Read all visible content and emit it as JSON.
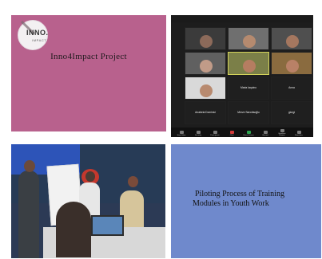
{
  "tiles": {
    "pink": {
      "logo_main": "INNO.",
      "logo_sub": "IMPACT",
      "title": "Inno4Impact Project",
      "bg_color": "#b8618d"
    },
    "zoom": {
      "participants": [
        {
          "name": "",
          "type": "video",
          "bg": "#3b3b3b",
          "head": "#8c6a5a",
          "active": false
        },
        {
          "name": "",
          "type": "video",
          "bg": "#6f6f6f",
          "head": "#b58a6f",
          "active": false
        },
        {
          "name": "",
          "type": "video",
          "bg": "#4f4f4f",
          "head": "#a5775f",
          "active": false
        },
        {
          "name": "",
          "type": "video",
          "bg": "#606060",
          "head": "#c19b88",
          "active": false
        },
        {
          "name": "",
          "type": "video",
          "bg": "#7b7f48",
          "head": "#b57d61",
          "active": true
        },
        {
          "name": "",
          "type": "video",
          "bg": "#8a6b3f",
          "head": "#b98167",
          "active": false
        },
        {
          "name": "",
          "type": "video",
          "bg": "#d9d9d9",
          "head": "#b88a6f",
          "active": false
        },
        {
          "name": "Maria Iaquino",
          "type": "text",
          "active": false
        },
        {
          "name": "Anna",
          "type": "text",
          "active": false
        },
        {
          "name": "Anabela Dominici",
          "type": "text",
          "active": false
        },
        {
          "name": "Merve Sarıcitaoğlu",
          "type": "text",
          "active": false
        },
        {
          "name": "giorgi",
          "type": "text",
          "active": false
        }
      ],
      "toolbar": [
        {
          "label": "Stop Video",
          "color": "gray"
        },
        {
          "label": "Security",
          "color": "gray"
        },
        {
          "label": "Participants",
          "color": "gray"
        },
        {
          "label": "Chat",
          "color": "red"
        },
        {
          "label": "Share Screen",
          "color": "green"
        },
        {
          "label": "Record",
          "color": "gray"
        },
        {
          "label": "Breakout Rooms",
          "color": "gray"
        },
        {
          "label": "Reactions",
          "color": "gray"
        }
      ]
    },
    "photo": {
      "description_colors": {
        "wall": "#2b3e58",
        "screen": "#2d54b8",
        "table": "#d8d8d8",
        "laptop": "#5a86b9"
      }
    },
    "blue": {
      "title_line1": "Piloting Process of Training",
      "title_line2": "Modules in Youth Work",
      "bg_color": "#6f89cc"
    }
  }
}
